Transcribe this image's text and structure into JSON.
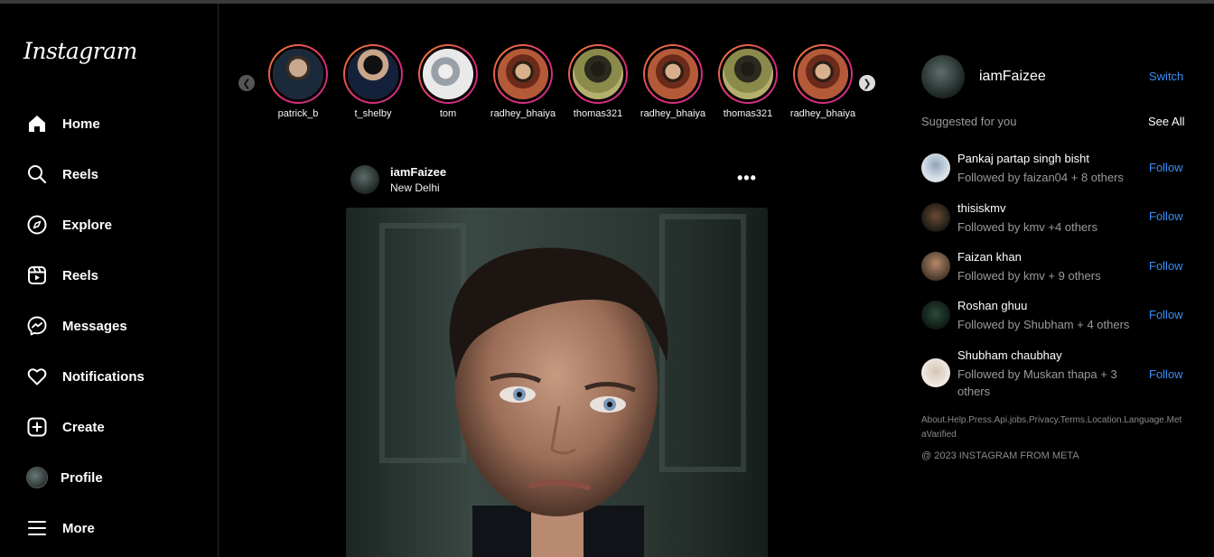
{
  "app": {
    "logo": "Instagram"
  },
  "sidebar": {
    "items": [
      {
        "label": "Home",
        "icon": "home-icon"
      },
      {
        "label": "Reels",
        "icon": "search-icon"
      },
      {
        "label": "Explore",
        "icon": "compass-icon"
      },
      {
        "label": "Reels",
        "icon": "reels-icon"
      },
      {
        "label": "Messages",
        "icon": "messenger-icon"
      },
      {
        "label": "Notifications",
        "icon": "heart-icon"
      },
      {
        "label": "Create",
        "icon": "plus-square-icon"
      },
      {
        "label": "Profile",
        "icon": "avatar"
      },
      {
        "label": "More",
        "icon": "menu-icon"
      }
    ]
  },
  "stories": {
    "prev_icon": "chevron-left-icon",
    "next_icon": "chevron-right-icon",
    "items": [
      {
        "name": "patrick_b"
      },
      {
        "name": "t_shelby"
      },
      {
        "name": "tom"
      },
      {
        "name": "radhey_bhaiya"
      },
      {
        "name": "thomas321"
      },
      {
        "name": "radhey_bhaiya"
      },
      {
        "name": "thomas321"
      },
      {
        "name": "radhey_bhaiya"
      }
    ]
  },
  "post": {
    "username": "iamFaizee",
    "location": "New Delhi",
    "more_icon": "•••"
  },
  "right": {
    "username": "iamFaizee",
    "switch_label": "Switch",
    "suggested_label": "Suggested for you",
    "see_all_label": "See All",
    "suggestions": [
      {
        "name": "Pankaj partap singh bisht",
        "sub": "Followed by faizan04 + 8 others",
        "action": "Follow"
      },
      {
        "name": "thisiskmv",
        "sub": "Followed by kmv +4 others",
        "action": "Follow"
      },
      {
        "name": "Faizan khan",
        "sub": "Followed by kmv + 9 others",
        "action": "Follow"
      },
      {
        "name": "Roshan ghuu",
        "sub": "Followed by Shubham + 4 others",
        "action": "Follow"
      },
      {
        "name": "Shubham chaubhay",
        "sub": "Followed by Muskan thapa + 3 others",
        "action": "Follow"
      }
    ],
    "footer_links": "About.Help.Press.Api.jobs.Privacy.Terms.Location.Language.MetaVarified",
    "copyright": "@ 2023 INSTAGRAM FROM META"
  },
  "colors": {
    "accent": "#3a8ff5",
    "background": "#000000",
    "muted": "#9a9a9a"
  }
}
